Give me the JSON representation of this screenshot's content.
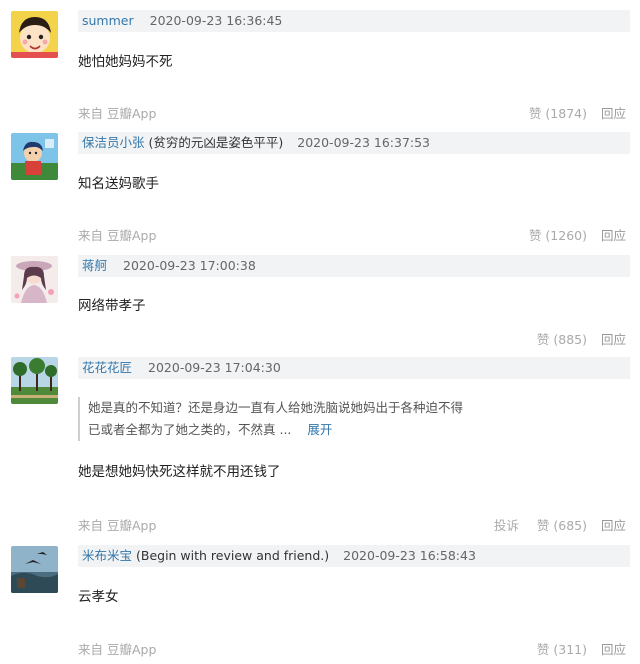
{
  "comments": [
    {
      "author": "summer",
      "signature": "",
      "time": "2020-09-23 16:36:45",
      "quote": null,
      "text": "她怕她妈妈不死",
      "source": "来自 豆瓣App",
      "report": "",
      "like": "赞 (1874)",
      "reply": "回应"
    },
    {
      "author": "保洁员小张",
      "signature": " (贫穷的元凶是姿色平平)",
      "time": "2020-09-23 16:37:53",
      "quote": null,
      "text": "知名送妈歌手",
      "source": "来自 豆瓣App",
      "report": "",
      "like": "赞 (1260)",
      "reply": "回应"
    },
    {
      "author": "蒋舸",
      "signature": "",
      "time": "2020-09-23 17:00:38",
      "quote": null,
      "text": "网络带孝子",
      "source": "",
      "report": "",
      "like": "赞 (885)",
      "reply": "回应"
    },
    {
      "author": "花花花匠",
      "signature": "",
      "time": "2020-09-23 17:04:30",
      "quote": {
        "line1": "她是真的不知道？还是身边一直有人给她洗脑说她妈出于各种迫不得",
        "line2": "已或者全都为了她之类的，不然真 ...",
        "expand": "展开"
      },
      "text": "她是想她妈快死这样就不用还钱了",
      "source": "来自 豆瓣App",
      "report": "投诉",
      "like": "赞 (685)",
      "reply": "回应"
    },
    {
      "author": "米布米宝",
      "signature": " (Begin with review and friend.)",
      "time": "2020-09-23 16:58:43",
      "quote": null,
      "text": "云孝女",
      "source": "来自 豆瓣App",
      "report": "",
      "like": "赞 (311)",
      "reply": "回应"
    }
  ],
  "avatars": [
    "cartoon-girl-avatar",
    "anime-boy-avatar",
    "illustrated-woman-avatar",
    "park-trees-avatar",
    "lake-bird-avatar"
  ]
}
